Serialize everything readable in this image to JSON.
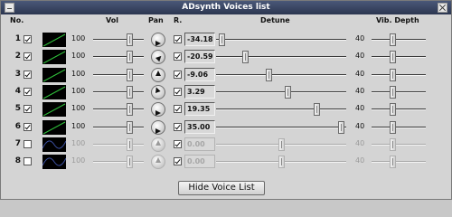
{
  "window": {
    "title": "ADsynth Voices list"
  },
  "headers": {
    "no": "No.",
    "vol": "Vol",
    "pan": "Pan",
    "r": "R.",
    "detune": "Detune",
    "vib_depth": "Vib. Depth"
  },
  "voices": [
    {
      "num": "1",
      "enabled": true,
      "vol": "100",
      "vol_level": 0.72,
      "pan_angle": 90,
      "r": true,
      "detune": "-34.18",
      "detune_pos": 0.04,
      "vib": "40",
      "vib_level": 0.38,
      "disabled": false,
      "wave": "ramp"
    },
    {
      "num": "2",
      "enabled": true,
      "vol": "100",
      "vol_level": 0.72,
      "pan_angle": 45,
      "r": true,
      "detune": "-20.59",
      "detune_pos": 0.22,
      "vib": "40",
      "vib_level": 0.38,
      "disabled": false,
      "wave": "ramp"
    },
    {
      "num": "3",
      "enabled": true,
      "vol": "100",
      "vol_level": 0.72,
      "pan_angle": 0,
      "r": true,
      "detune": "-9.06",
      "detune_pos": 0.4,
      "vib": "40",
      "vib_level": 0.38,
      "disabled": false,
      "wave": "ramp"
    },
    {
      "num": "4",
      "enabled": true,
      "vol": "100",
      "vol_level": 0.72,
      "pan_angle": -20,
      "r": true,
      "detune": "3.29",
      "detune_pos": 0.55,
      "vib": "40",
      "vib_level": 0.38,
      "disabled": false,
      "wave": "ramp"
    },
    {
      "num": "5",
      "enabled": true,
      "vol": "100",
      "vol_level": 0.72,
      "pan_angle": 90,
      "r": true,
      "detune": "19.35",
      "detune_pos": 0.77,
      "vib": "40",
      "vib_level": 0.38,
      "disabled": false,
      "wave": "ramp"
    },
    {
      "num": "6",
      "enabled": true,
      "vol": "100",
      "vol_level": 0.72,
      "pan_angle": 90,
      "r": true,
      "detune": "35.00",
      "detune_pos": 0.96,
      "vib": "40",
      "vib_level": 0.38,
      "disabled": false,
      "wave": "ramp"
    },
    {
      "num": "7",
      "enabled": false,
      "vol": "100",
      "vol_level": 0.72,
      "pan_angle": 0,
      "r": true,
      "detune": "0.00",
      "detune_pos": 0.5,
      "vib": "40",
      "vib_level": 0.38,
      "disabled": true,
      "wave": "sine"
    },
    {
      "num": "8",
      "enabled": false,
      "vol": "100",
      "vol_level": 0.72,
      "pan_angle": 0,
      "r": true,
      "detune": "0.00",
      "detune_pos": 0.5,
      "vib": "40",
      "vib_level": 0.38,
      "disabled": true,
      "wave": "sine"
    }
  ],
  "hide_button": {
    "label": "Hide Voice List"
  },
  "colors": {
    "titlebar": "#3a4662",
    "osc_bg": "#000000",
    "osc_line": "#2fbf3a",
    "osc_line_disabled": "#3b4fa0"
  }
}
